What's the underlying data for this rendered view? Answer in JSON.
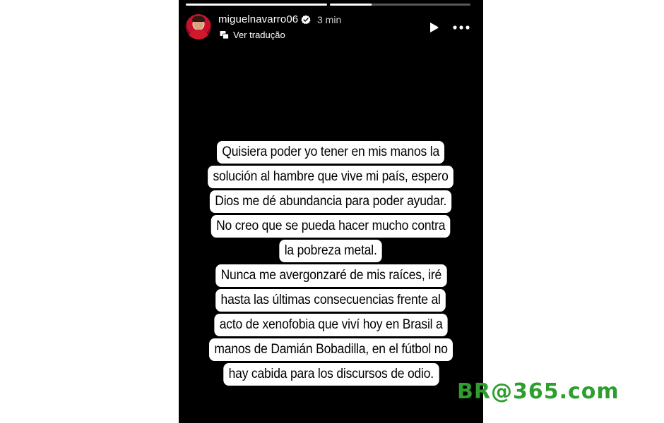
{
  "story": {
    "username": "miguelnavarro06",
    "time_ago": "3 min",
    "translate_label": "Ver tradução",
    "progress": [
      1.0,
      0.3
    ],
    "text_lines": [
      "Quisiera poder yo tener en mis manos la",
      "solución al hambre que vive mi país, espero",
      "Dios me dé abundancia para poder ayudar.",
      "No creo que se pueda hacer mucho contra",
      "la pobreza metal.",
      "Nunca me avergonzaré de mis raíces, iré",
      "hasta las últimas consecuencias frente al",
      "acto de xenofobia que viví hoy en Brasil a",
      "manos de Damián Bobadilla, en el fútbol no",
      "hay cabida para los discursos de odio."
    ],
    "icons": {
      "verified": "verified-badge-icon",
      "translate": "translate-icon",
      "play": "play-icon",
      "more": "more-options-icon"
    }
  },
  "watermark": {
    "text": "BR@365.com",
    "color": "#2e9e2e"
  },
  "colors": {
    "story_background": "#000000",
    "text_background": "#ffffff",
    "text_color": "#000000"
  }
}
